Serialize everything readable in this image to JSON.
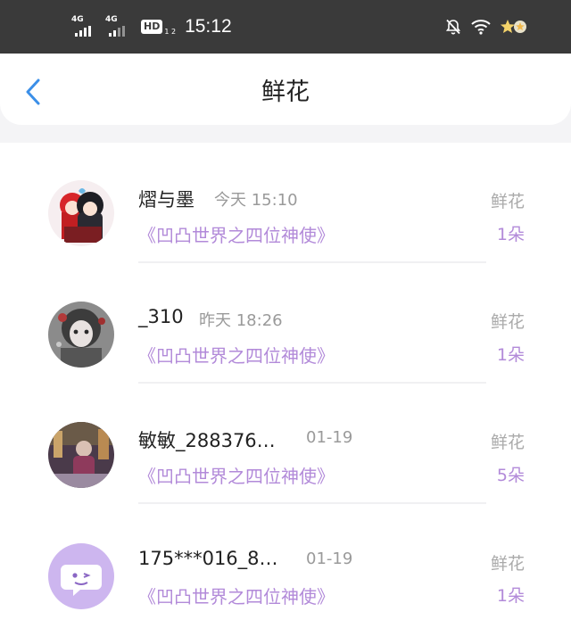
{
  "status_bar": {
    "signal1_label": "4G",
    "signal2_label": "4G",
    "hd_label": "HD",
    "hd_sub": "1 2",
    "time": "15:12",
    "icons": [
      "mute-bell-icon",
      "wifi-icon",
      "star-badge-icon"
    ]
  },
  "header": {
    "title": "鲜花",
    "back_icon": "chevron-left-icon"
  },
  "colors": {
    "accent_purple": "#b28ad9",
    "back_blue": "#3b8fe8",
    "status_bg": "#3a3a3a"
  },
  "entries": [
    {
      "name": "熠与墨",
      "time": "今天 15:10",
      "book": "《凹凸世界之四位神使》",
      "gift_label": "鲜花",
      "count": "1朵",
      "avatar": "anime-couple-avatar"
    },
    {
      "name": "_310",
      "time": "昨天 18:26",
      "book": "《凹凸世界之四位神使》",
      "gift_label": "鲜花",
      "count": "1朵",
      "avatar": "anime-girl-avatar"
    },
    {
      "name": "敏敏_288376…",
      "time": "01-19",
      "book": "《凹凸世界之四位神使》",
      "gift_label": "鲜花",
      "count": "5朵",
      "avatar": "photo-avatar"
    },
    {
      "name": "175***016_8…",
      "time": "01-19",
      "book": "《凹凸世界之四位神使》",
      "gift_label": "鲜花",
      "count": "1朵",
      "avatar": "default-chat-avatar"
    }
  ]
}
